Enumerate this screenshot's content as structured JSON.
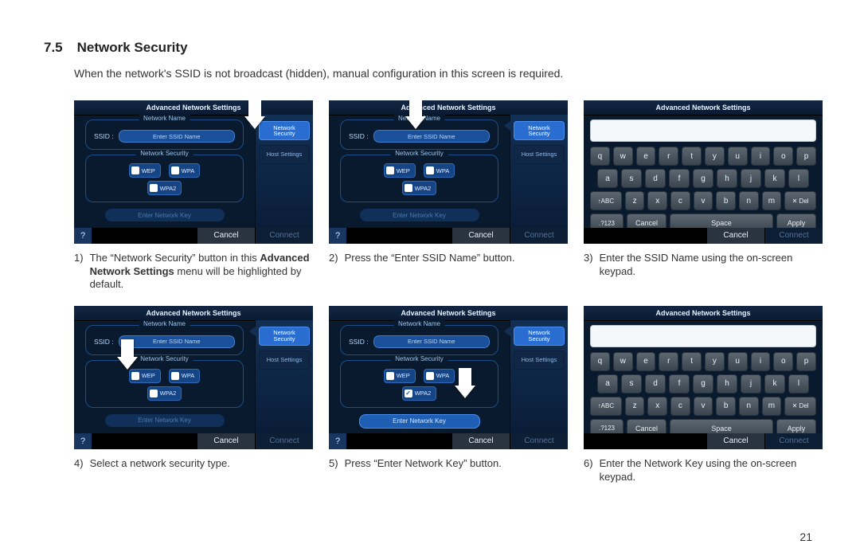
{
  "heading_number": "7.5",
  "heading_title": "Network Security",
  "intro": "When the network's SSID is not broadcast (hidden), manual configuration in this screen is required.",
  "page_number": "21",
  "panel": {
    "title": "Advanced Network Settings",
    "side_tab1": "Network\nSecurity",
    "side_tab2": "Host Settings",
    "group_name_label": "Network Name",
    "ssid_label": "SSID :",
    "ssid_button": "Enter SSID Name",
    "group_sec_label": "Network Security",
    "wep": "WEP",
    "wpa": "WPA",
    "wpa2": "WPA2",
    "enter_key": "Enter Network Key",
    "help": "?",
    "cancel": "Cancel",
    "connect": "Connect"
  },
  "keyboard": {
    "row1": [
      "q",
      "w",
      "e",
      "r",
      "t",
      "y",
      "u",
      "i",
      "o",
      "p"
    ],
    "row2": [
      "a",
      "s",
      "d",
      "f",
      "g",
      "h",
      "j",
      "k",
      "l"
    ],
    "abc": "ABC",
    "row3": [
      "z",
      "x",
      "c",
      "v",
      "b",
      "n",
      "m"
    ],
    "del": "✕ Del",
    "mode": ".?123",
    "cancel": "Cancel",
    "space": "Space",
    "apply": "Apply"
  },
  "captions": {
    "c1_num": "1)",
    "c1_html": "The “Network Security” button in this <b>Advanced Network Settings</b> menu will be highlighted by default.",
    "c2_num": "2)",
    "c2": "Press the “Enter SSID Name” button.",
    "c3_num": "3)",
    "c3": "Enter the SSID Name using the on-screen keypad.",
    "c4_num": "4)",
    "c4": "Select a network security type.",
    "c5_num": "5)",
    "c5": "Press “Enter Network Key” button.",
    "c6_num": "6)",
    "c6": "Enter the Network Key using the on-screen keypad."
  }
}
